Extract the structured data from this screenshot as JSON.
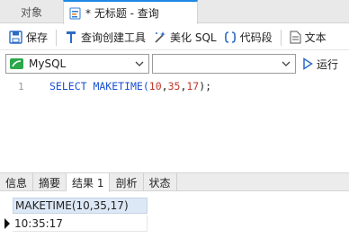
{
  "tabs": {
    "objects": "对象",
    "query": "* 无标题 - 查询"
  },
  "toolbar": {
    "save": "保存",
    "query_builder": "查询创建工具",
    "beautify_sql": "美化 SQL",
    "code_snippet": "代码段",
    "text": "文本"
  },
  "selectors": {
    "connection": "MySQL",
    "database": "",
    "run": "运行"
  },
  "editor": {
    "line_number": "1",
    "code_kw": "SELECT MAKETIME(",
    "arg1": "10",
    "arg2": "35",
    "arg3": "17",
    "code_end": ");"
  },
  "result_tabs": [
    "信息",
    "摘要",
    "结果 1",
    "剖析",
    "状态"
  ],
  "result": {
    "column": "MAKETIME(10,35,17)",
    "value": "10:35:17"
  },
  "colors": {
    "accent": "#1e88e5",
    "keyword": "#1a4fd1",
    "number": "#c0392b",
    "header_bg": "#dde8f6"
  }
}
